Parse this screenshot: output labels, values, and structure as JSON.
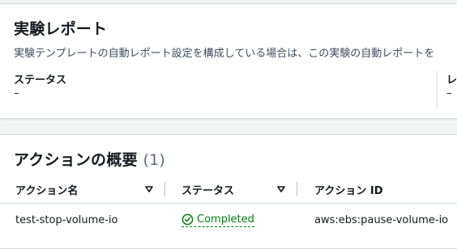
{
  "report_panel": {
    "title": "実験レポート",
    "description": "実験テンプレートの自動レポート設定を構成している場合は、この実験の自動レポートを",
    "status_label": "ステータス",
    "status_value": "–",
    "right_label_fragment": "レ",
    "right_value_fragment": "–"
  },
  "actions_panel": {
    "title": "アクションの概要",
    "count": "(1)",
    "columns": {
      "name": "アクション名",
      "status": "ステータス",
      "action_id": "アクション ID"
    },
    "rows": [
      {
        "name": "test-stop-volume-io",
        "status": "Completed",
        "action_id": "aws:ebs:pause-volume-io"
      }
    ]
  },
  "colors": {
    "success": "#037f0c",
    "border": "#d5dbdb",
    "background": "#f2f3f3"
  },
  "icons": {
    "status_completed": "check-circle-icon",
    "sort": "caret-down-icon"
  }
}
